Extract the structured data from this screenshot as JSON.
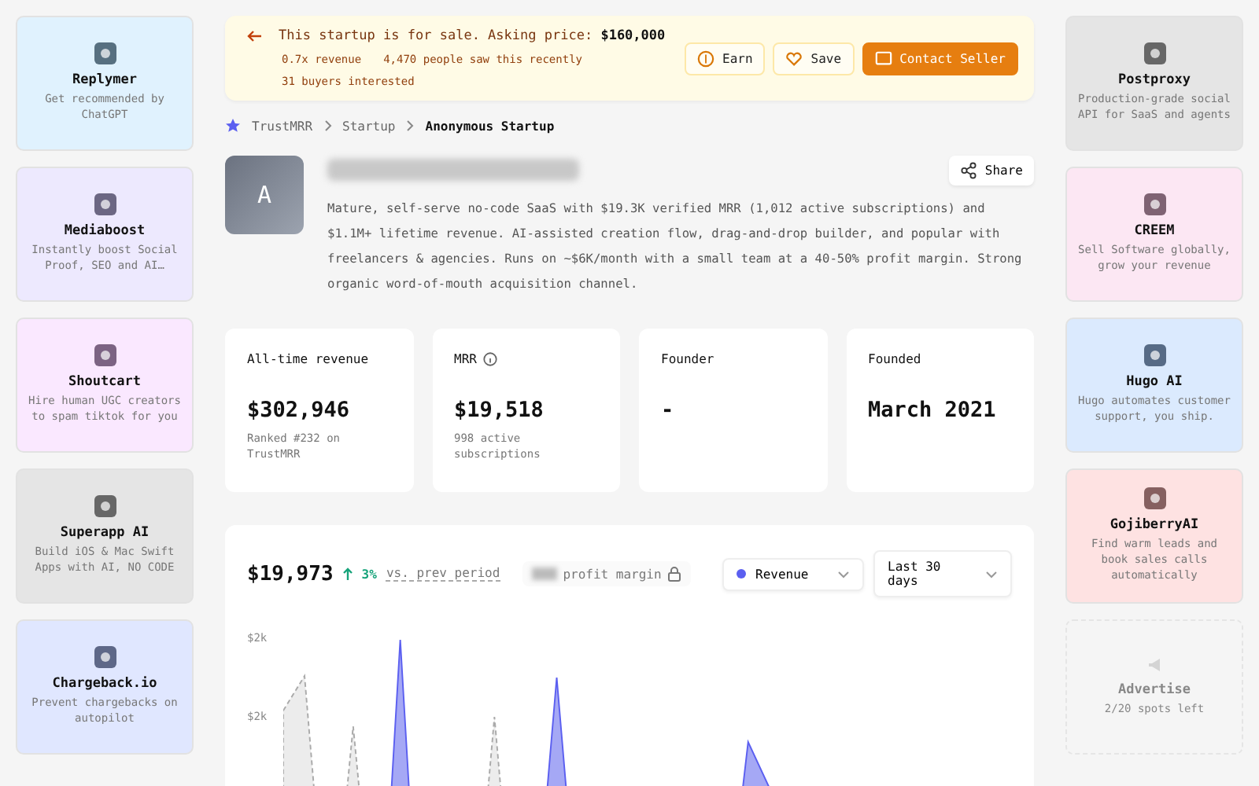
{
  "left_ads": [
    {
      "name": "Replymer",
      "description": "Get recommended by ChatGPT",
      "color": "#e0f2fe",
      "kind": "sponsor"
    },
    {
      "name": "Mediaboost",
      "description": "Instantly boost Social Proof, SEO and AI…",
      "color": "#ede9fe",
      "kind": "sponsor"
    },
    {
      "name": "Shoutcart",
      "description": "Hire human UGC creators to spam tiktok for you",
      "color": "#fae8ff",
      "kind": "sponsor"
    },
    {
      "name": "Superapp AI",
      "description": "Build iOS & Mac Swift Apps with AI, NO CODE",
      "color": "#e5e5e5",
      "kind": "sponsor"
    },
    {
      "name": "Chargeback.io",
      "description": "Prevent chargebacks on autopilot",
      "color": "#e0e7ff",
      "kind": "sponsor"
    }
  ],
  "right_ads": [
    {
      "name": "Postproxy",
      "description": "Production-grade social API for SaaS and agents",
      "color": "#e5e5e5",
      "kind": "sponsor"
    },
    {
      "name": "CREEM",
      "description": "Sell Software globally, grow your revenue",
      "color": "#fce7f3",
      "kind": "sponsor"
    },
    {
      "name": "Hugo AI",
      "description": "Hugo automates customer support, you ship.",
      "color": "#dbeafe",
      "kind": "sponsor"
    },
    {
      "name": "GojiberryAI",
      "description": "Find warm leads and book sales calls automatically",
      "color": "#fee2e2",
      "kind": "sponsor"
    },
    {
      "name": "Advertise",
      "description": "2/20 spots left",
      "color": "#f5f5f5",
      "kind": "open_slot"
    }
  ],
  "sale_banner": {
    "text": "This startup is for sale. Asking price: **$160,000**",
    "stats": [
      "0.7x revenue",
      "4,470 people saw this recently",
      "31 buyers interested"
    ],
    "buttons": [
      {
        "label": "Earn",
        "kind": "earn"
      },
      {
        "label": "Save",
        "kind": "save"
      },
      {
        "label": "Contact Seller",
        "kind": "contact"
      }
    ]
  },
  "breadcrumb": [
    {
      "label": "TrustMRR",
      "current": false
    },
    {
      "label": "Startup",
      "current": false
    },
    {
      "label": "Anonymous Startup",
      "current": true
    }
  ],
  "startup": {
    "avatar_letter": "A",
    "share_label": "Share",
    "description": "Mature, self-serve no-code SaaS with $19.3K verified MRR (1,012 active subscriptions) and $1.1M+ lifetime revenue. AI-assisted creation flow, drag-and-drop builder, and popular with freelancers & agencies. Runs on ~$6K/month with a small team at a 40-50% profit margin. Strong organic word-of-mouth acquisition channel."
  },
  "stats": [
    {
      "label": "All-time revenue",
      "value": "$302,946",
      "note": "Ranked #232 on TrustMRR",
      "info": false
    },
    {
      "label": "MRR",
      "value": "$19,518",
      "note": "998 active subscriptions",
      "info": true
    },
    {
      "label": "Founder",
      "value": "-",
      "info": false
    },
    {
      "label": "Founded",
      "value": "March 2021",
      "info": false
    }
  ],
  "chart_panel": {
    "total": "$19,973",
    "change": "3%",
    "comparison": "vs. prev period",
    "profit_label": "profit margin",
    "profit_locked": true,
    "metric": {
      "label": "Revenue",
      "color": "#5b5ff0"
    },
    "range": "Last 30 days",
    "axis_labels": [
      "$2k",
      "$2k"
    ]
  }
}
